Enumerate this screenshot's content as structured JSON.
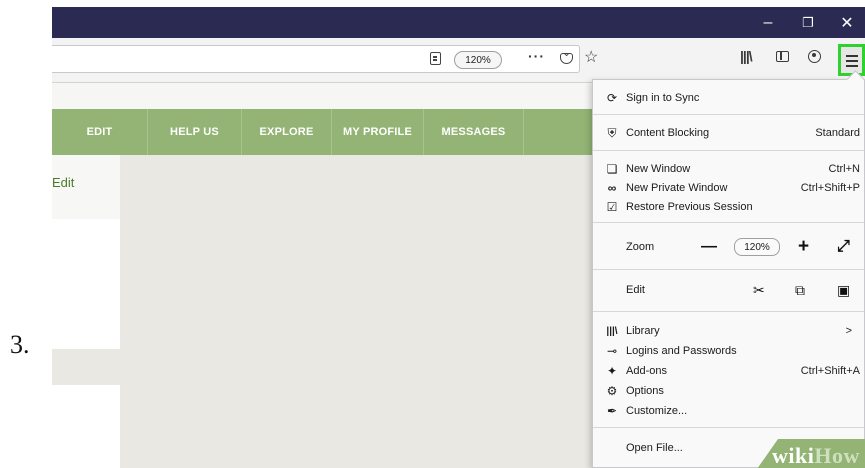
{
  "step": {
    "number": "3."
  },
  "toolbar": {
    "zoom_level": "120%",
    "more_icon": "···"
  },
  "nav": {
    "items": [
      "EDIT",
      "HELP US",
      "EXPLORE",
      "MY PROFILE",
      "MESSAGES"
    ]
  },
  "page": {
    "edit_link": "Edit"
  },
  "menu": {
    "sign_in": "Sign in to Sync",
    "content_blocking": {
      "label": "Content Blocking",
      "value": "Standard"
    },
    "new_window": {
      "label": "New Window",
      "shortcut": "Ctrl+N"
    },
    "new_private_window": {
      "label": "New Private Window",
      "shortcut": "Ctrl+Shift+P"
    },
    "restore_session": "Restore Previous Session",
    "zoom": {
      "label": "Zoom",
      "minus": "—",
      "value": "120%",
      "plus": "+",
      "fullscreen": "⤢"
    },
    "edit": {
      "label": "Edit"
    },
    "library": {
      "label": "Library",
      "arrow": ">"
    },
    "logins": "Logins and Passwords",
    "addons": {
      "label": "Add-ons",
      "shortcut": "Ctrl+Shift+A"
    },
    "options": "Options",
    "customize": "Customize...",
    "open_file": "Open File..."
  },
  "watermark": {
    "part1": "wiki",
    "part2": "How"
  },
  "colors": {
    "titlebar": "#2a2a52",
    "nav_green": "#93b474",
    "highlight": "#2fd12f"
  }
}
